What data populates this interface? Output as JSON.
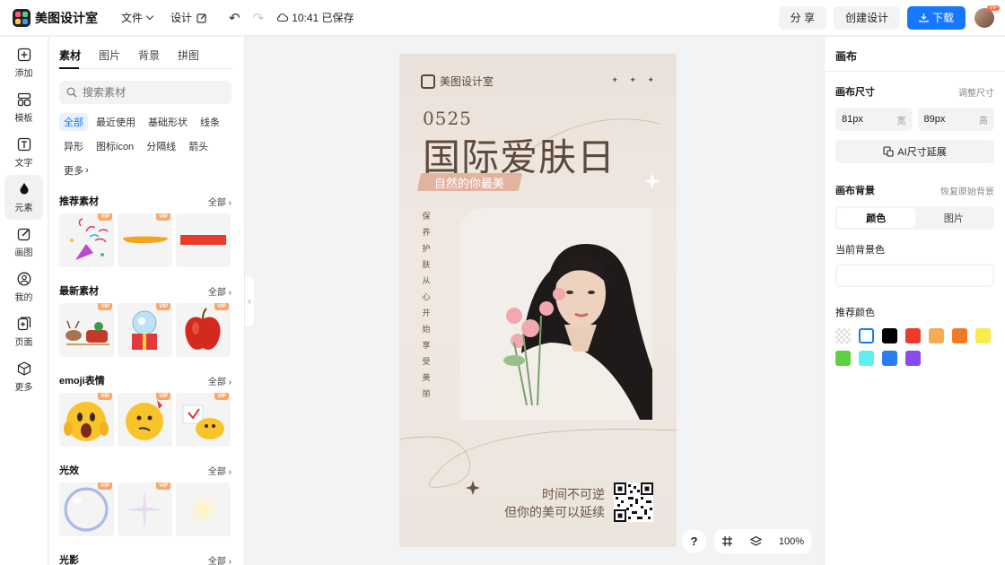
{
  "app": {
    "name": "美图设计室"
  },
  "menu": {
    "file": "文件",
    "design": "设计",
    "saved_status": "10:41 已保存"
  },
  "top_actions": {
    "share": "分 享",
    "create": "创建设计",
    "download": "下载",
    "avatar_badge": "VIP"
  },
  "rail": [
    {
      "label": "添加",
      "icon": "plus-square-icon"
    },
    {
      "label": "模板",
      "icon": "template-icon"
    },
    {
      "label": "文字",
      "icon": "text-icon"
    },
    {
      "label": "元素",
      "icon": "shapes-icon"
    },
    {
      "label": "画图",
      "icon": "pencil-icon"
    },
    {
      "label": "我的",
      "icon": "user-icon"
    },
    {
      "label": "页面",
      "icon": "page-icon"
    },
    {
      "label": "更多",
      "icon": "cube-icon"
    }
  ],
  "panel": {
    "tabs": [
      "素材",
      "图片",
      "背景",
      "拼图"
    ],
    "search_placeholder": "搜索素材",
    "chips": [
      "全部",
      "最近使用",
      "基础形状",
      "线条",
      "异形",
      "图标icon",
      "分隔线",
      "箭头",
      "更多"
    ],
    "vip_label": "VIP",
    "sections": [
      {
        "title": "推荐素材",
        "all": "全部"
      },
      {
        "title": "最新素材",
        "all": "全部"
      },
      {
        "title": "emoji表情",
        "all": "全部"
      },
      {
        "title": "光效",
        "all": "全部"
      },
      {
        "title": "光影",
        "all": "全部"
      }
    ]
  },
  "canvas": {
    "brand": "美图设计室",
    "stars": "✦ ✦ ✦",
    "date": "0525",
    "title": "国际爱肤日",
    "tag": "自然的你最美",
    "vertical_text": [
      "保",
      "养",
      "护",
      "肤",
      "从",
      "心",
      "开",
      "始",
      "享",
      "受",
      "美",
      "丽"
    ],
    "slogan_line1": "时间不可逆",
    "slogan_line2": "但你的美可以延续"
  },
  "float_toolbar": {
    "help": "?",
    "zoom": "100%"
  },
  "right_panel": {
    "title": "画布",
    "size_label": "画布尺寸",
    "size_action": "调整尺寸",
    "width_value": "81px",
    "width_unit": "宽",
    "height_value": "89px",
    "height_unit": "高",
    "ai_extend": "AI尺寸延展",
    "bg_label": "画布背景",
    "bg_action": "恢复原始背景",
    "bg_tabs": [
      "颜色",
      "图片"
    ],
    "current_bg": "当前背景色",
    "recommend": "推荐颜色",
    "colors": [
      "transparent",
      "#ffffff",
      "#000000",
      "#ee3a2a",
      "#f5ad52",
      "#f07a2a",
      "#f8ec4a",
      "#5fcf3f",
      "#5ff0ee",
      "#2a7ff0",
      "#8a4af0"
    ]
  },
  "accent": "#1677ff"
}
